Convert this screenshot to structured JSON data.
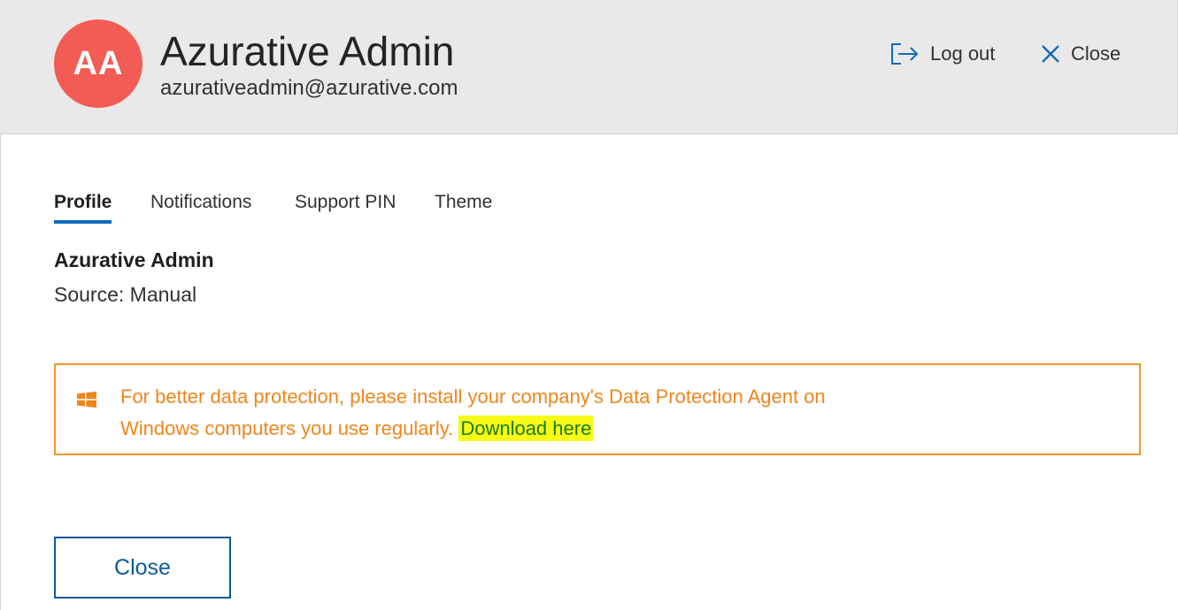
{
  "header": {
    "avatar_initials": "AA",
    "avatar_color": "#f25c54",
    "user_name": "Azurative Admin",
    "user_email": "azurativeadmin@azurative.com",
    "logout_label": "Log out",
    "logout_icon": "sign-out-icon",
    "close_label": "Close",
    "close_icon": "close-icon"
  },
  "tabs": [
    {
      "label": "Profile",
      "active": true
    },
    {
      "label": "Notifications",
      "active": false
    },
    {
      "label": "Support PIN",
      "active": false
    },
    {
      "label": "Theme",
      "active": false
    }
  ],
  "profile": {
    "name": "Azurative Admin",
    "source": "Source: Manual"
  },
  "notice": {
    "icon": "windows-logo-icon",
    "line1": "For better data protection, please install your company's Data Protection Agent on",
    "line2": "Windows computers you use regularly.",
    "link_label": "Download here",
    "accent_color": "#f0962d",
    "link_highlight": "#f7fb17"
  },
  "footer": {
    "close_button_label": "Close"
  },
  "colors": {
    "header_bg": "#e9e9e9",
    "primary": "#0f6cbd",
    "button_border": "#0e5a96"
  }
}
